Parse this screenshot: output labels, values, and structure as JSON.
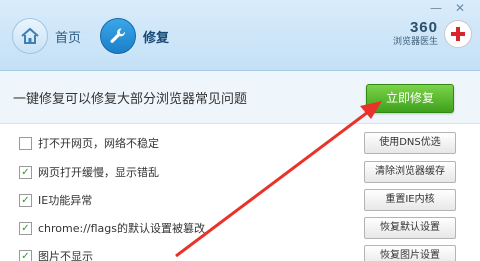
{
  "window": {
    "minimize": "—",
    "close": "✕"
  },
  "nav": {
    "home_label": "首页",
    "repair_label": "修复"
  },
  "brand": {
    "number": "360",
    "subtitle": "浏览器医生"
  },
  "banner": {
    "text": "一键修复可以修复大部分浏览器常见问题",
    "button_label": "立即修复"
  },
  "rows": [
    {
      "label": "打不开网页，网络不稳定",
      "checked": false,
      "button": "使用DNS优选"
    },
    {
      "label": "网页打开缓慢，显示错乱",
      "checked": true,
      "button": "清除浏览器缓存"
    },
    {
      "label": "IE功能异常",
      "checked": true,
      "button": "重置IE内核"
    },
    {
      "label": "chrome://flags的默认设置被篡改",
      "checked": true,
      "button": "恢复默认设置"
    },
    {
      "label": "图片不显示",
      "checked": true,
      "button": "恢复图片设置"
    }
  ],
  "colors": {
    "accent_green": "#3ea11c",
    "nav_blue": "#1b7fc8",
    "arrow_red": "#e8322a"
  },
  "icons": [
    "home-icon",
    "wrench-icon",
    "medical-cross-icon",
    "checkmark-icon"
  ]
}
